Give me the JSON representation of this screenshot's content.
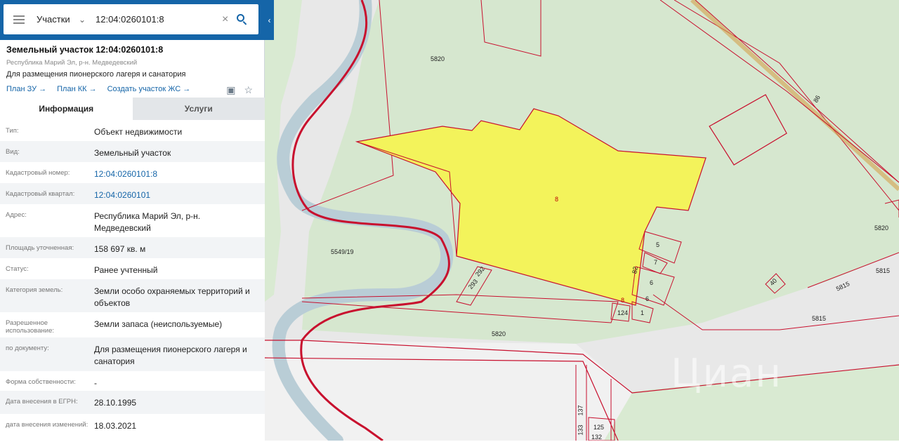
{
  "search": {
    "category": "Участки",
    "query": "12:04:0260101:8"
  },
  "parcel": {
    "title": "Земельный участок 12:04:0260101:8",
    "region": "Республика Марий Эл, р-н. Медведевский",
    "purpose": "Для размещения пионерского лагеря и санатория",
    "links": [
      "План ЗУ →",
      "План КК →",
      "Создать участок ЖС →"
    ]
  },
  "tabs": [
    "Информация",
    "Услуги"
  ],
  "info_rows": [
    {
      "key": "Тип:",
      "value": "Объект недвижимости"
    },
    {
      "key": "Вид:",
      "value": "Земельный участок"
    },
    {
      "key": "Кадастровый номер:",
      "value": "12:04:0260101:8"
    },
    {
      "key": "Кадастровый квартал:",
      "value": "12:04:0260101"
    },
    {
      "key": "Адрес:",
      "value": "Республика Марий Эл, р-н. Медведевский"
    },
    {
      "key": "Площадь уточненная:",
      "value": "158 697 кв. м"
    },
    {
      "key": "Статус:",
      "value": "Ранее учтенный"
    },
    {
      "key": "Категория земель:",
      "value": "Земли особо охраняемых территорий и объектов"
    },
    {
      "key": "Разрешенное использование:",
      "value": "Земли запаса (неиспользуемые)"
    },
    {
      "key": "по документу:",
      "value": "Для размещения пионерского лагеря и санатория"
    },
    {
      "key": "Форма собственности:",
      "value": "-"
    },
    {
      "key": "Дата внесения в ЕГРН:",
      "value": "28.10.1995"
    },
    {
      "key": "дата внесения изменений:",
      "value": "18.03.2021"
    }
  ],
  "map_labels": {
    "l5820a": "5820",
    "l5820b": "5820",
    "l5820c": "5820",
    "l5815a": "5815",
    "l5815b": "5815",
    "l5815c": "5815",
    "l5549": "5549/19",
    "l8a": "8",
    "l8b": "8",
    "l5": "5",
    "l7": "7",
    "l6a": "6",
    "l6b": "6",
    "l82": "82",
    "l1": "1",
    "l124": "124",
    "l292": "292",
    "l293": "293",
    "l40": "40",
    "l86": "86",
    "l137": "137",
    "l133": "133",
    "l125": "125",
    "l132": "132"
  },
  "watermark": "Циан",
  "colors": {
    "header": "#1565a8",
    "parcel": "#f3f35b",
    "boundary": "#c8102e"
  }
}
